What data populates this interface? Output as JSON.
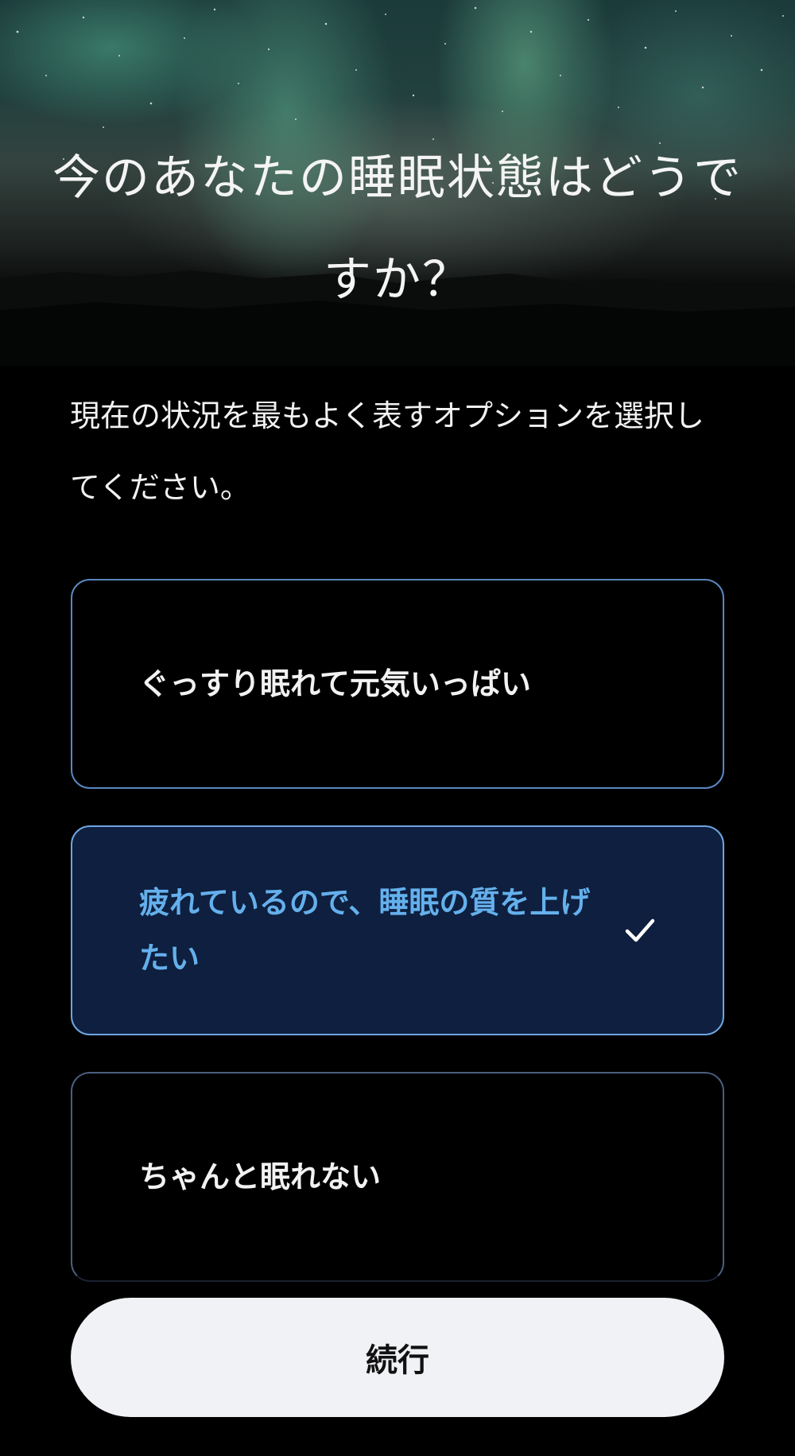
{
  "header": {
    "title": "今のあなたの睡眠状態はどうですか？",
    "background": "aurora-night-sky"
  },
  "main": {
    "subtitle": "現在の状況を最もよく表すオプションを選択してください。",
    "options": [
      {
        "label": "ぐっすり眠れて元気いっぱい",
        "selected": false
      },
      {
        "label": "疲れているので、睡眠の質を上げたい",
        "selected": true,
        "icon": "checkmark-icon"
      },
      {
        "label": "ちゃんと眠れない",
        "selected": false
      }
    ]
  },
  "footer": {
    "continue_label": "続行"
  },
  "colors": {
    "background": "#000000",
    "option_border": "#5a87bf",
    "selected_background": "#0e1f3f",
    "selected_text": "#64b0ec",
    "button_background": "#f1f2f5"
  }
}
